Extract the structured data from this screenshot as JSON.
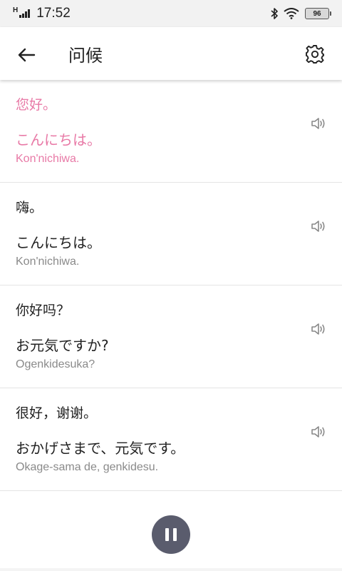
{
  "status_bar": {
    "network_type": "H",
    "time": "17:52",
    "battery": "96",
    "icons": [
      "signal-icon",
      "bluetooth-icon",
      "wifi-icon",
      "battery-icon"
    ]
  },
  "header": {
    "title": "问候",
    "back_icon": "arrow-left-icon",
    "settings_icon": "gear-icon"
  },
  "phrases": [
    {
      "zh": "您好。",
      "ja": "こんにちは。",
      "romaji": "Kon'nichiwa.",
      "active": true
    },
    {
      "zh": "嗨。",
      "ja": "こんにちは。",
      "romaji": "Kon'nichiwa.",
      "active": false
    },
    {
      "zh": "你好吗？",
      "ja": "お元気ですか?",
      "romaji": "Ogenkidesuka?",
      "active": false
    },
    {
      "zh": "很好，谢谢。",
      "ja": "おかげさまで、元気です。",
      "romaji": "Okage-sama de, genkidesu.",
      "active": false
    }
  ],
  "colors": {
    "active_text": "#e879a6",
    "normal_text": "#222222",
    "romaji_text": "#8a8a8a",
    "pause_button": "#5a5c6d"
  }
}
